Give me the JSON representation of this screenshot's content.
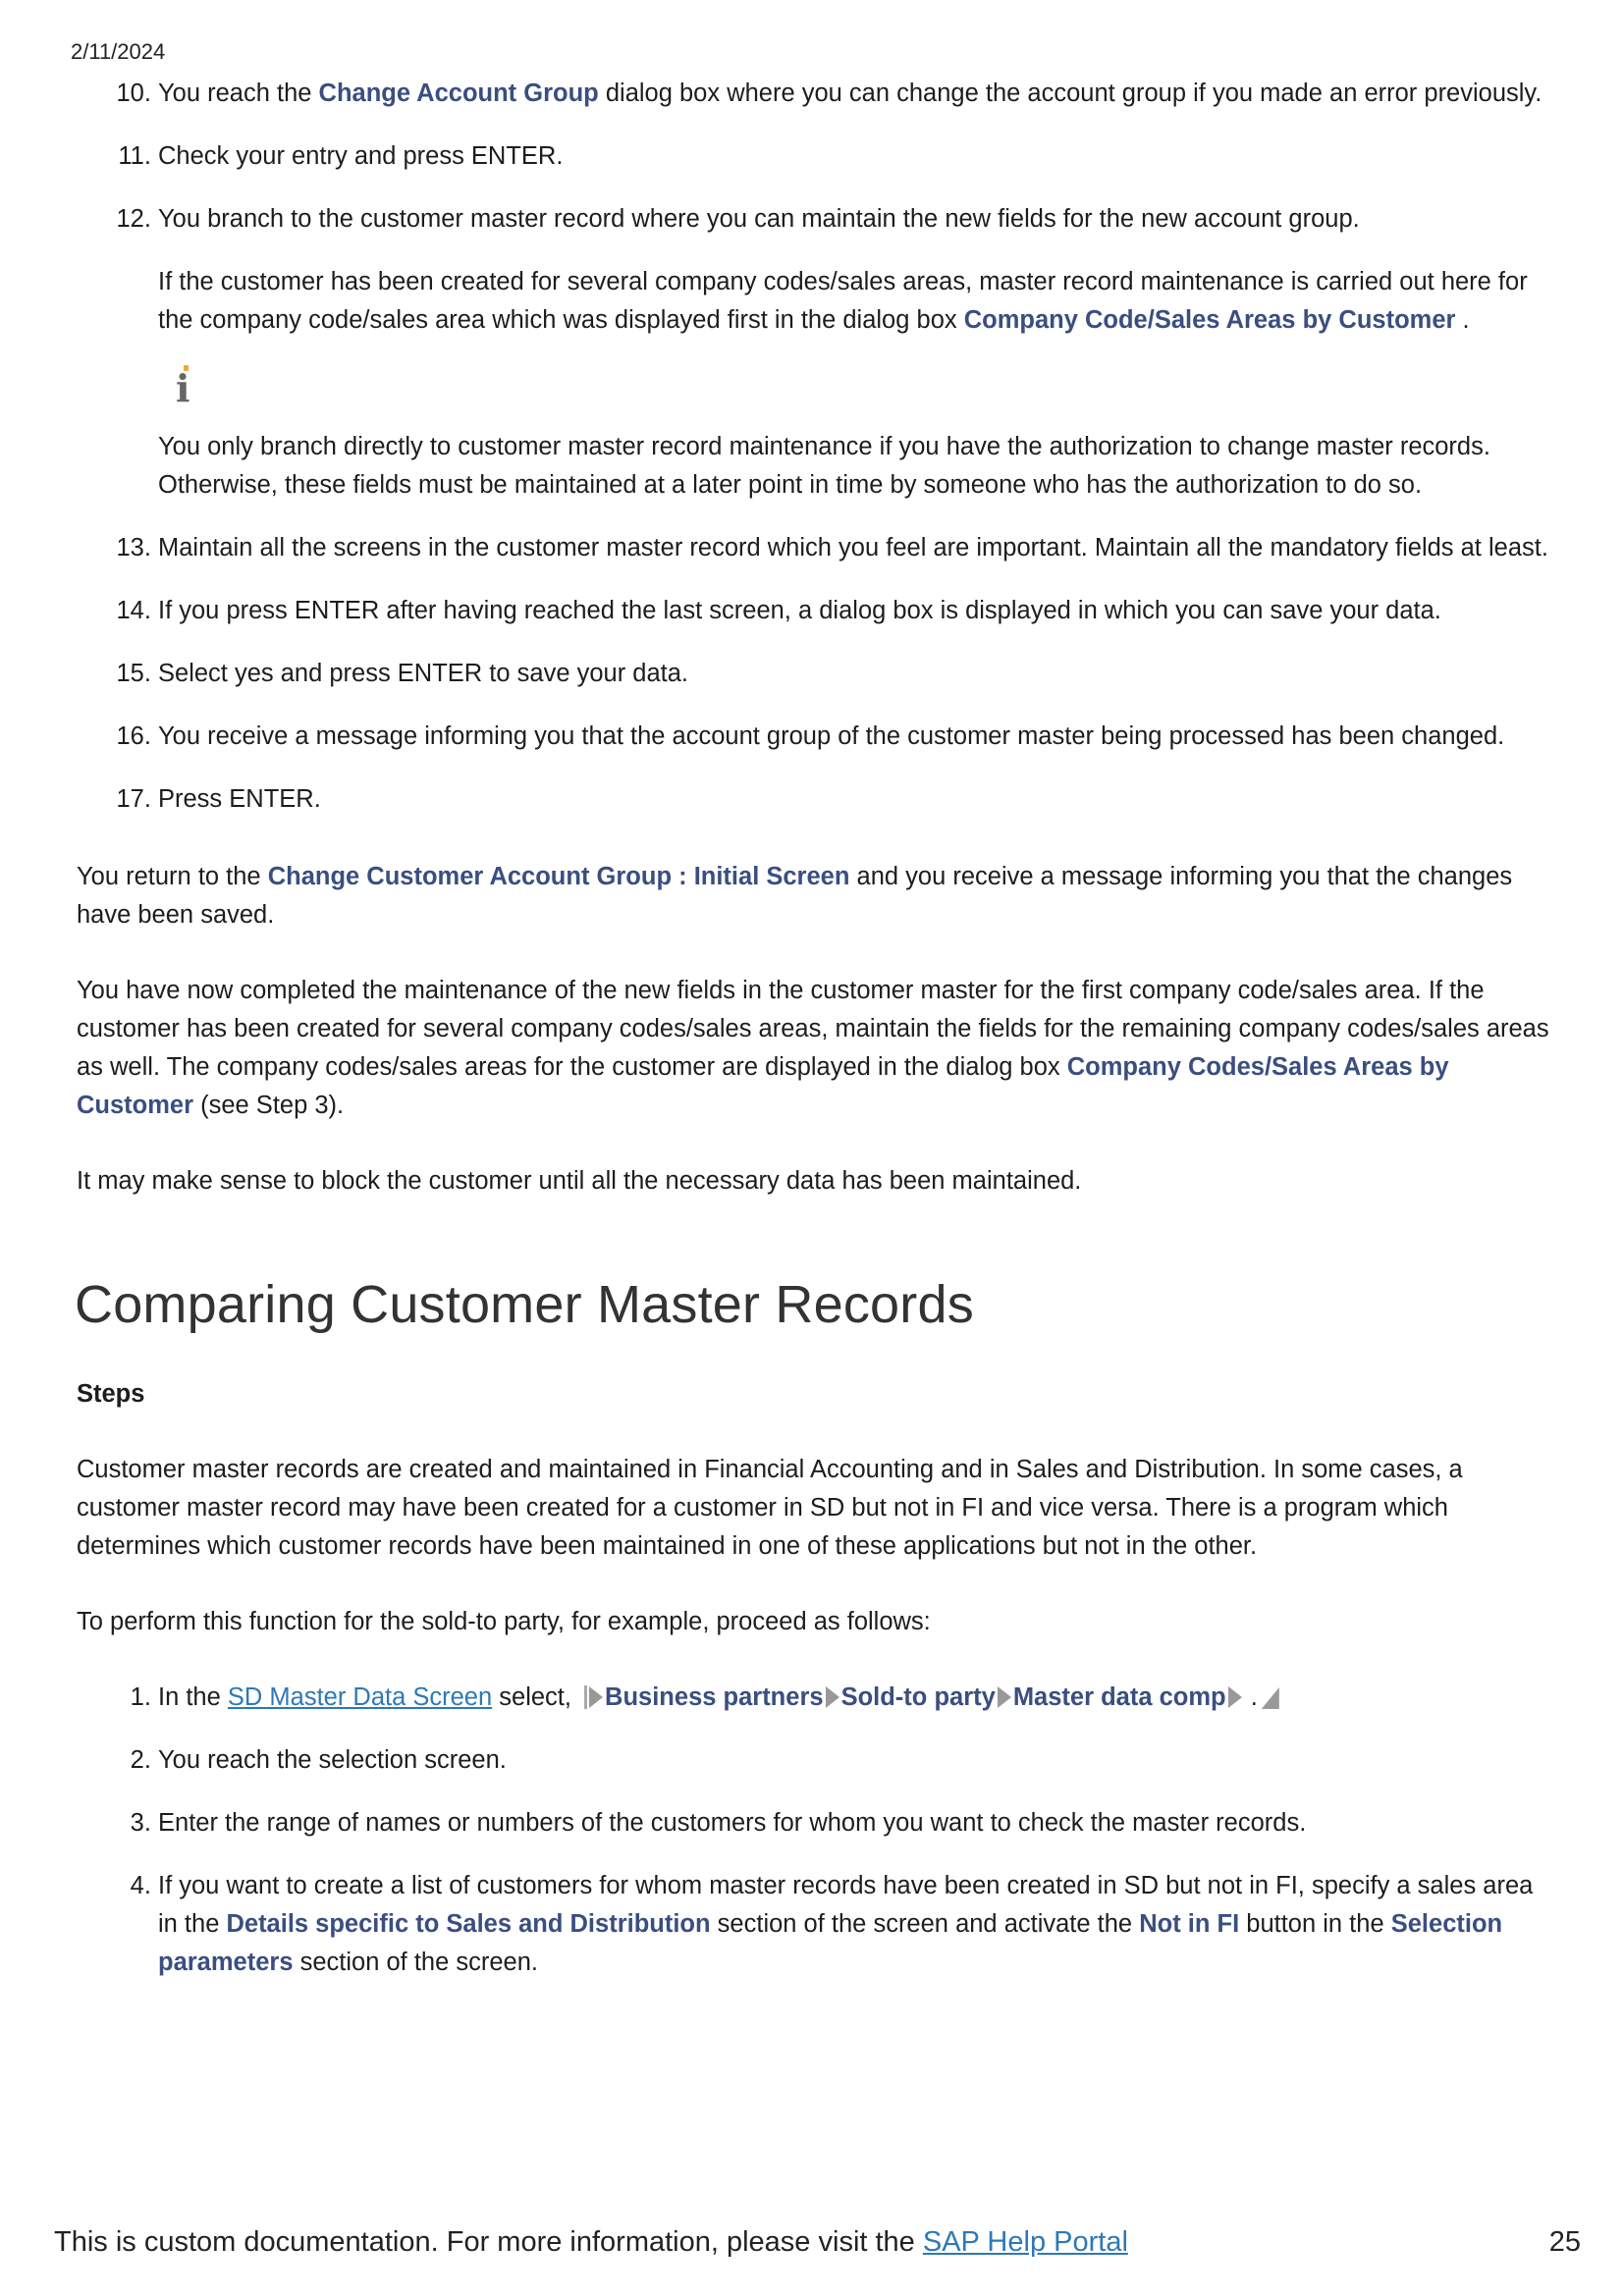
{
  "header": {
    "date": "2/11/2024"
  },
  "list1": {
    "i10": {
      "a": "You reach the ",
      "kw": "Change Account Group",
      "b": " dialog box where you can change the account group if you made an error previously."
    },
    "i11": "Check your entry and press ENTER.",
    "i12": {
      "text": "You branch to the customer master record where you can maintain the new fields for the new account group.",
      "p1a": "If the customer has been created for several company codes/sales areas, master record maintenance is carried out here for the company code/sales area which was displayed first in the dialog box ",
      "p1kw": "Company Code/Sales Areas by Customer",
      "p1b": " .",
      "info_icon": "info-icon",
      "p2": "You only branch directly to customer master record maintenance if you have the authorization to change master records. Otherwise, these fields must be maintained at a later point in time by someone who has the authorization to do so."
    },
    "i13": "Maintain all the screens in the customer master record which you feel are important. Maintain all the mandatory fields at least.",
    "i14": "If you press ENTER after having reached the last screen, a dialog box is displayed in which you can save your data.",
    "i15": "Select yes and press ENTER to save your data.",
    "i16": "You receive a message informing you that the account group of the customer master being processed has been changed.",
    "i17": "Press ENTER."
  },
  "para1": {
    "a": "You return to the ",
    "kw": "Change Customer Account Group : Initial Screen",
    "b": " and you receive a message informing you that the changes have been saved."
  },
  "para2": {
    "a": "You have now completed the maintenance of the new fields in the customer master for the first company code/sales area. If the customer has been created for several company codes/sales areas, maintain the fields for the remaining company codes/sales areas as well. The company codes/sales areas for the customer are displayed in the dialog box ",
    "kw": "Company Codes/Sales Areas by Customer",
    "b": " (see Step 3)."
  },
  "para3": "It may make sense to block the customer until all the necessary data has been maintained.",
  "section": {
    "title": "Comparing Customer Master Records",
    "steps_heading": "Steps",
    "intro": "Customer master records are created and maintained in Financial Accounting and in Sales and Distribution. In some cases, a customer master record may have been created for a customer in SD but not in FI and vice versa. There is a program which determines which customer records have been maintained in one of these applications but not in the other.",
    "lead": "To perform this function for the sold-to party, for example, proceed as follows:",
    "s1": {
      "a": "In the ",
      "link": "SD Master Data Screen",
      "b": " select, ",
      "path1": "Business partners",
      "path2": "Sold-to party",
      "path3": "Master data comp",
      "end": " ."
    },
    "s2": "You reach the selection screen.",
    "s3": "Enter the range of names or numbers of the customers for whom you want to check the master records.",
    "s4": {
      "a": "If you want to create a list of customers for whom master records have been created in SD but not in FI, specify a sales area in the ",
      "kw1": "Details specific to Sales and Distribution",
      "b": " section of the screen and activate the ",
      "kw2": "Not in FI",
      "c": " button in the ",
      "kw3": "Selection parameters",
      "d": " section of the screen."
    }
  },
  "footer": {
    "text": "This is custom documentation. For more information, please visit the ",
    "link": "SAP Help Portal",
    "page": "25"
  },
  "colors": {
    "keyword": "#3a4e80",
    "link": "#2e78b7",
    "info_dot": "#f0a830"
  }
}
